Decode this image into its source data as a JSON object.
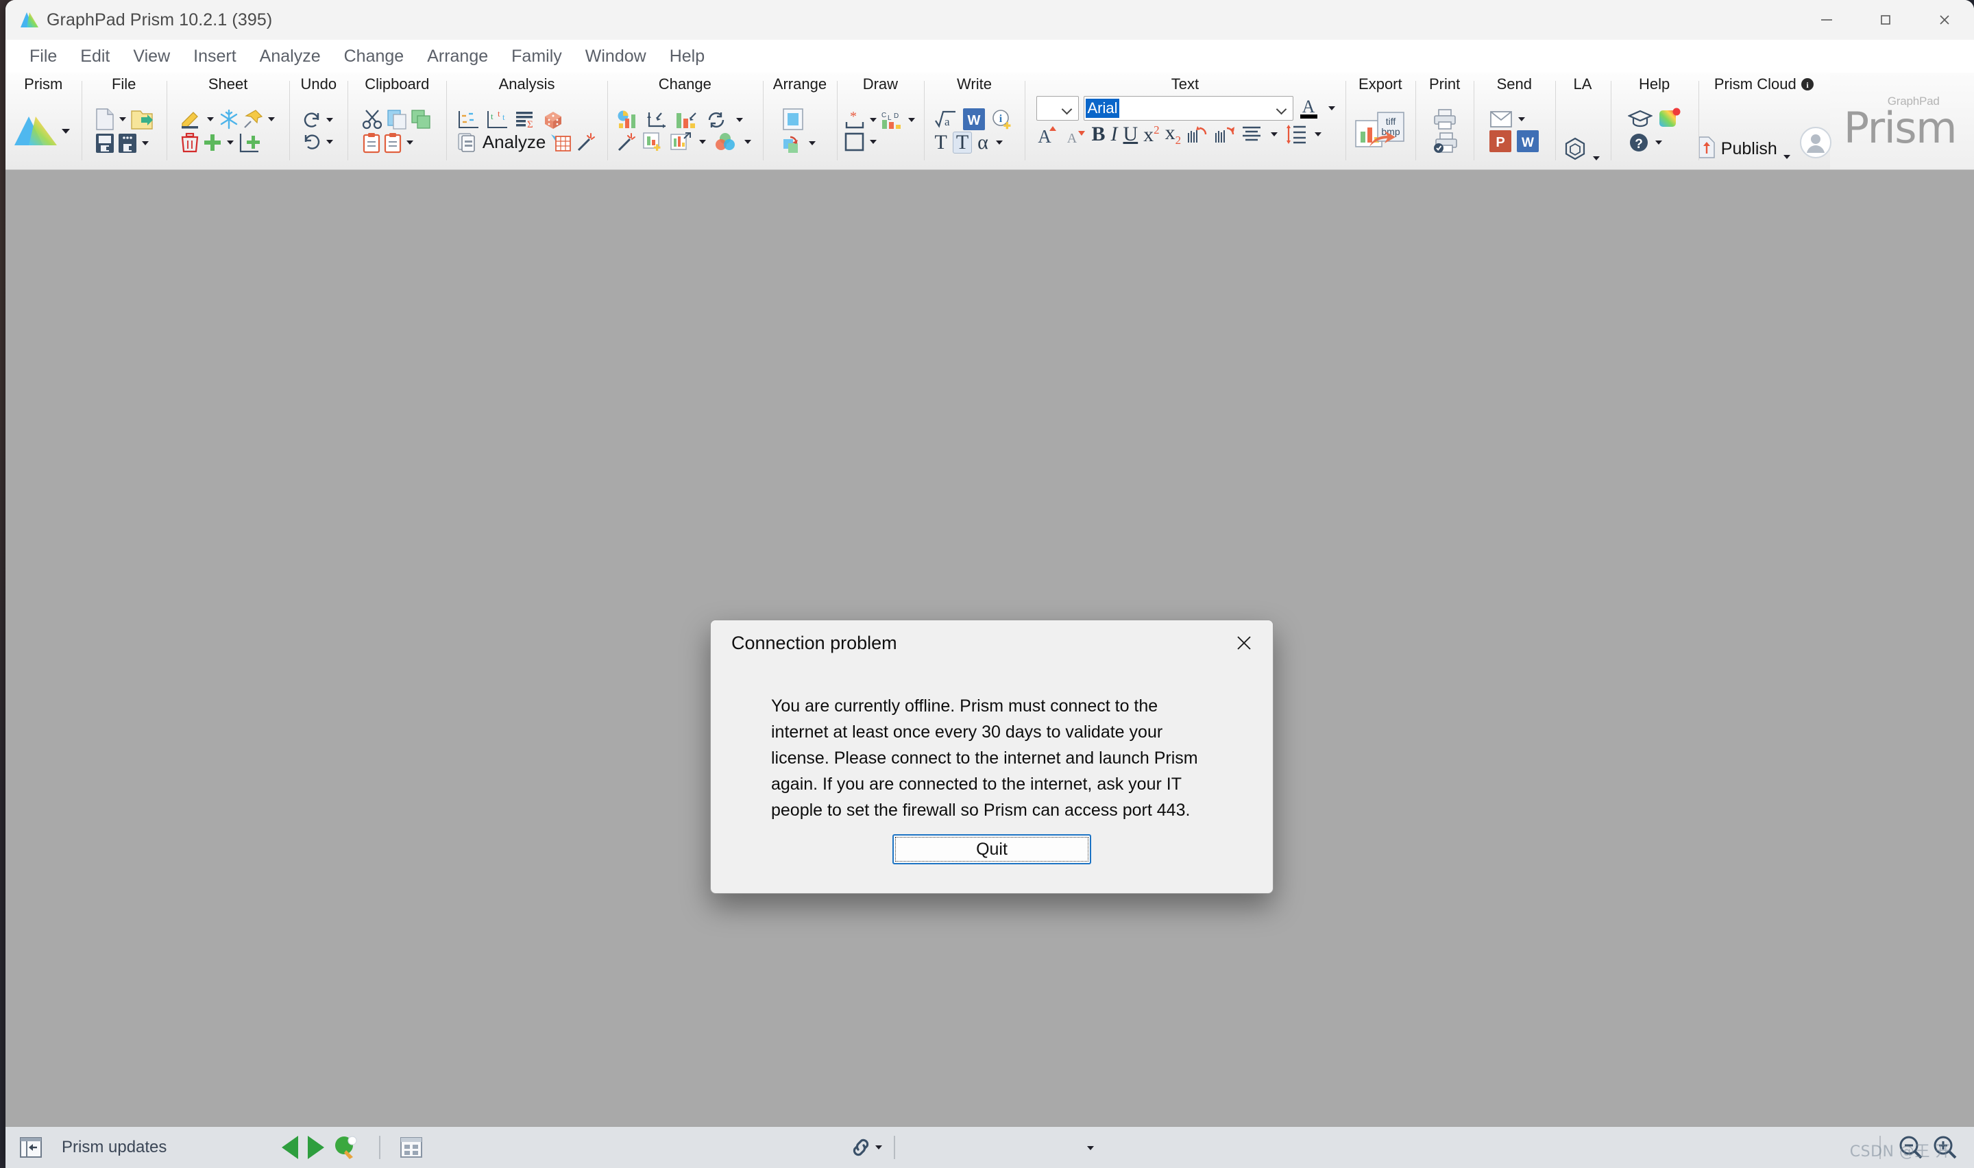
{
  "window": {
    "title": "GraphPad Prism 10.2.1 (395)",
    "logo_icon": "prism-triangle-logo-icon",
    "controls": [
      {
        "name": "minimize",
        "icon": "minimize-icon"
      },
      {
        "name": "maximize",
        "icon": "maximize-icon"
      },
      {
        "name": "close",
        "icon": "close-icon"
      }
    ]
  },
  "menubar": {
    "items": [
      {
        "label": "File"
      },
      {
        "label": "Edit"
      },
      {
        "label": "View"
      },
      {
        "label": "Insert"
      },
      {
        "label": "Analyze"
      },
      {
        "label": "Change"
      },
      {
        "label": "Arrange"
      },
      {
        "label": "Family"
      },
      {
        "label": "Window"
      },
      {
        "label": "Help"
      }
    ]
  },
  "ribbon": {
    "groups": [
      {
        "title": "Prism",
        "icons": [
          "prism-logo-icon"
        ]
      },
      {
        "title": "File",
        "icons": [
          "new-file-icon",
          "open-folder-icon",
          "save-icon",
          "save-as-icon"
        ]
      },
      {
        "title": "Sheet",
        "icons": [
          "rename-sheet-icon",
          "freeze-icon",
          "pin-icon",
          "delete-sheet-icon",
          "new-sheet-icon",
          "duplicate-sheet-icon"
        ]
      },
      {
        "title": "Undo",
        "icons": [
          "redo-icon",
          "undo-icon"
        ]
      },
      {
        "title": "Clipboard",
        "icons": [
          "cut-icon",
          "copy-icon",
          "duplicate-icon",
          "paste-icon",
          "paste-special-icon"
        ]
      },
      {
        "title": "Analysis",
        "icons": [
          "interpolate-icon",
          "t-test-icon",
          "summary-icon",
          "simulate-dice-icon",
          "analyze-icon",
          "results-sheet-icon",
          "magic-wand-icon"
        ],
        "analyze_label": "Analyze"
      },
      {
        "title": "Change",
        "icons": [
          "graph-type-icon",
          "axes-icon",
          "bar-scale-icon",
          "refresh-icon",
          "magic-wand-icon",
          "add-graph-icon",
          "resize-graph-icon",
          "color-scheme-icon"
        ]
      },
      {
        "title": "Arrange",
        "icons": [
          "frame-icon",
          "send-backward-icon"
        ]
      },
      {
        "title": "Draw",
        "icons": [
          "asterisk-bracket-icon",
          "cld-letters-icon",
          "rectangle-icon"
        ]
      },
      {
        "title": "Write",
        "icons": [
          "equation-icon",
          "word-icon",
          "info-plus-icon",
          "text-icon",
          "text-box-icon",
          "greek-alpha-icon"
        ]
      },
      {
        "title": "Text",
        "icons": [
          "grow-font-icon",
          "shrink-font-icon",
          "bold-icon",
          "italic-icon",
          "underline-icon",
          "superscript-icon",
          "subscript-icon",
          "rotate-ccw-text-icon",
          "rotate-cw-text-icon",
          "align-icon",
          "line-spacing-icon",
          "font-color-icon"
        ],
        "font_size_value": "",
        "font_name_value": "Arial",
        "bold_label": "B",
        "italic_label": "I",
        "underline_label": "U"
      },
      {
        "title": "Export",
        "icons": [
          "export-tiff-bmp-icon"
        ],
        "export_label_1": "tiff",
        "export_label_2": "bmp"
      },
      {
        "title": "Print",
        "icons": [
          "print-icon",
          "print-preview-icon"
        ]
      },
      {
        "title": "Send",
        "icons": [
          "email-icon",
          "powerpoint-icon",
          "word-send-icon"
        ],
        "ppt_label": "P",
        "word_label": "W"
      },
      {
        "title": "LA",
        "icons": [
          "labarchives-icon"
        ]
      },
      {
        "title": "Help",
        "icons": [
          "graduation-cap-icon",
          "whats-new-icon",
          "help-question-icon"
        ]
      },
      {
        "title": "Prism Cloud",
        "icons": [
          "info-icon",
          "publish-upload-icon",
          "account-avatar-icon"
        ],
        "publish_label": "Publish"
      }
    ],
    "brand": {
      "sub": "GraphPad",
      "name": "Prism"
    }
  },
  "dialog": {
    "title": "Connection problem",
    "close_icon": "close-icon",
    "message": "You are currently offline. Prism must connect to the internet at least once every 30 days to validate your license. Please connect to the internet and launch Prism again. If you are connected to the internet, ask your IT people to set the firewall so Prism can access port 443.",
    "primary_button": "Quit"
  },
  "statusbar": {
    "collapse_icon": "collapse-panel-icon",
    "updates_label": "Prism updates",
    "prev_icon": "prev-sheet-icon",
    "next_icon": "next-sheet-icon",
    "paddle_icon": "pingpong-paddle-icon",
    "sheets_icon": "sheets-grid-icon",
    "link_icon": "link-chain-icon",
    "dropdown_icon": "chevron-down-icon",
    "zoom_out_icon": "zoom-out-icon",
    "zoom_in_icon": "zoom-in-icon",
    "watermark": "CSDN @王 开"
  },
  "colors": {
    "accent": "#1d74c4",
    "selection": "#0a66c9",
    "workspace": "#a9a9a9",
    "ribbon_bg": "#f2f2f2",
    "statusbar_bg": "#dfe2e6"
  }
}
